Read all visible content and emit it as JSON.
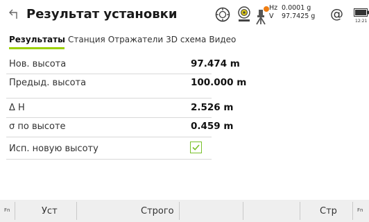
{
  "header": {
    "title": "Результат установки",
    "hz_label": "Hz",
    "hz_value": "0.0001 g",
    "v_label": "V",
    "v_value": "97.7425 g",
    "at_symbol": "@",
    "clock": "12:21",
    "accent": "#9bd000"
  },
  "tabs": [
    {
      "label": "Результаты",
      "active": true
    },
    {
      "label": "Станция",
      "active": false
    },
    {
      "label": "Отражатели",
      "active": false
    },
    {
      "label": "3D схема",
      "active": false
    },
    {
      "label": "Видео",
      "active": false
    }
  ],
  "results": {
    "new_height_label": "Нов. высота",
    "new_height_value": "97.474 m",
    "prev_height_label": "Предыд. высота",
    "prev_height_value": "100.000 m",
    "delta_h_label": "Δ H",
    "delta_h_value": "2.526 m",
    "sigma_label": "σ по высоте",
    "sigma_value": "0.459 m",
    "use_new_height_label": "Исп. новую высоту",
    "use_new_height_checked": true
  },
  "function_bar": {
    "fn_left": "Fn",
    "key1": "Уст",
    "key2": "Строго",
    "key5": "Стр",
    "fn_right": "Fn"
  }
}
